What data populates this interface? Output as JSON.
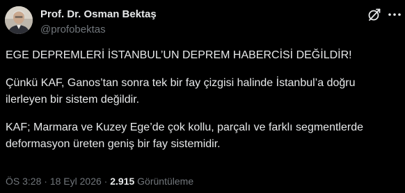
{
  "author": {
    "display_name": "Prof. Dr. Osman Bektaş",
    "handle": "@profobektas"
  },
  "icons": {
    "grok": "grok-icon",
    "more": "more-icon"
  },
  "tweet": {
    "paragraphs": [
      "EGE DEPREMLERİ İSTANBUL’UN DEPREM HABERCİSİ DEĞİLDİR!",
      "Çünkü KAF, Ganos’tan sonra tek bir fay çizgisi halinde İstanbul’a doğru ilerleyen bir sistem değildir.",
      "KAF; Marmara ve Kuzey Ege’de çok kollu, parçalı ve farklı segmentlerde deformasyon üreten geniş bir fay sistemidir."
    ]
  },
  "meta": {
    "time": "ÖS 3:28",
    "separator": "·",
    "date": "18 Eyl 2026",
    "views_count": "2.915",
    "views_label": "Görüntüleme"
  },
  "colors": {
    "background": "#000000",
    "text": "#e7e9ea",
    "secondary": "#71767b"
  }
}
